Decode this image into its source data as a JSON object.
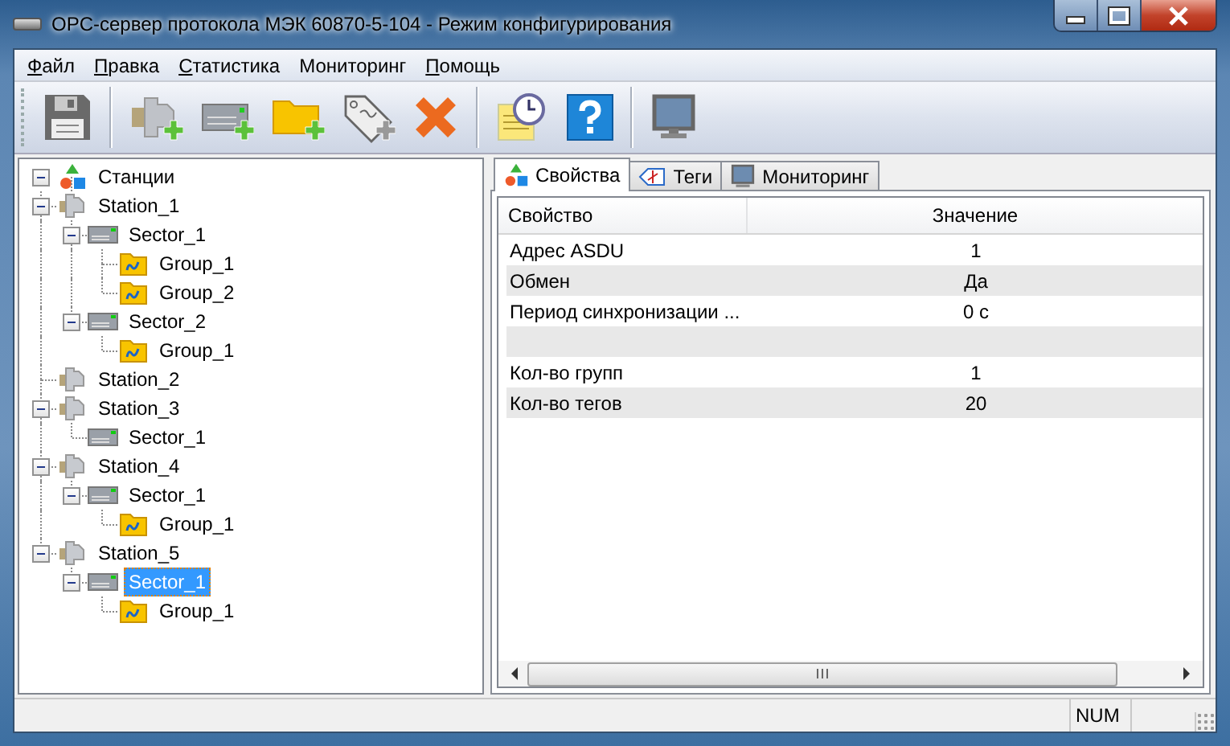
{
  "window": {
    "title": "OPC-сервер протокола МЭК 60870-5-104 - Режим конфигурирования"
  },
  "menu": [
    {
      "label": "Файл",
      "underlined": true
    },
    {
      "label": "Правка",
      "underlined": true
    },
    {
      "label": "Статистика",
      "underlined": true
    },
    {
      "label": "Мониторинг",
      "underlined": false
    },
    {
      "label": "Помощь",
      "underlined": true
    }
  ],
  "tree": [
    {
      "label": "Станции",
      "kind": "root",
      "expanded": true,
      "selected": false,
      "children": [
        {
          "label": "Station_1",
          "kind": "station",
          "expanded": true,
          "selected": false,
          "children": [
            {
              "label": "Sector_1",
              "kind": "sector",
              "expanded": true,
              "selected": false,
              "children": [
                {
                  "label": "Group_1",
                  "kind": "group",
                  "selected": false
                },
                {
                  "label": "Group_2",
                  "kind": "group",
                  "selected": false
                }
              ]
            },
            {
              "label": "Sector_2",
              "kind": "sector",
              "expanded": true,
              "selected": false,
              "children": [
                {
                  "label": "Group_1",
                  "kind": "group",
                  "selected": false
                }
              ]
            }
          ]
        },
        {
          "label": "Station_2",
          "kind": "station",
          "selected": false
        },
        {
          "label": "Station_3",
          "kind": "station",
          "expanded": true,
          "selected": false,
          "children": [
            {
              "label": "Sector_1",
              "kind": "sector",
              "selected": false
            }
          ]
        },
        {
          "label": "Station_4",
          "kind": "station",
          "expanded": true,
          "selected": false,
          "children": [
            {
              "label": "Sector_1",
              "kind": "sector",
              "expanded": true,
              "selected": false,
              "children": [
                {
                  "label": "Group_1",
                  "kind": "group",
                  "selected": false
                }
              ]
            }
          ]
        },
        {
          "label": "Station_5",
          "kind": "station",
          "expanded": true,
          "selected": false,
          "children": [
            {
              "label": "Sector_1",
              "kind": "sector",
              "expanded": true,
              "selected": true,
              "children": [
                {
                  "label": "Group_1",
                  "kind": "group",
                  "selected": false
                }
              ]
            }
          ]
        }
      ]
    }
  ],
  "tabs": [
    {
      "label": "Свойства",
      "kind": "properties",
      "selected": true
    },
    {
      "label": "Теги",
      "kind": "tags",
      "selected": false
    },
    {
      "label": "Мониторинг",
      "kind": "monitoring",
      "selected": false
    }
  ],
  "table": {
    "columns": [
      "Свойство",
      "Значение"
    ],
    "rows": [
      {
        "property": "Адрес ASDU",
        "value": "1"
      },
      {
        "property": "Обмен",
        "value": "Да"
      },
      {
        "property": "Период синхронизации ...",
        "value": "0 с"
      },
      {},
      {
        "property": "Кол-во групп",
        "value": "1"
      },
      {
        "property": "Кол-во тегов",
        "value": "20"
      }
    ]
  },
  "status_bar": {
    "indicator": "NUM"
  }
}
